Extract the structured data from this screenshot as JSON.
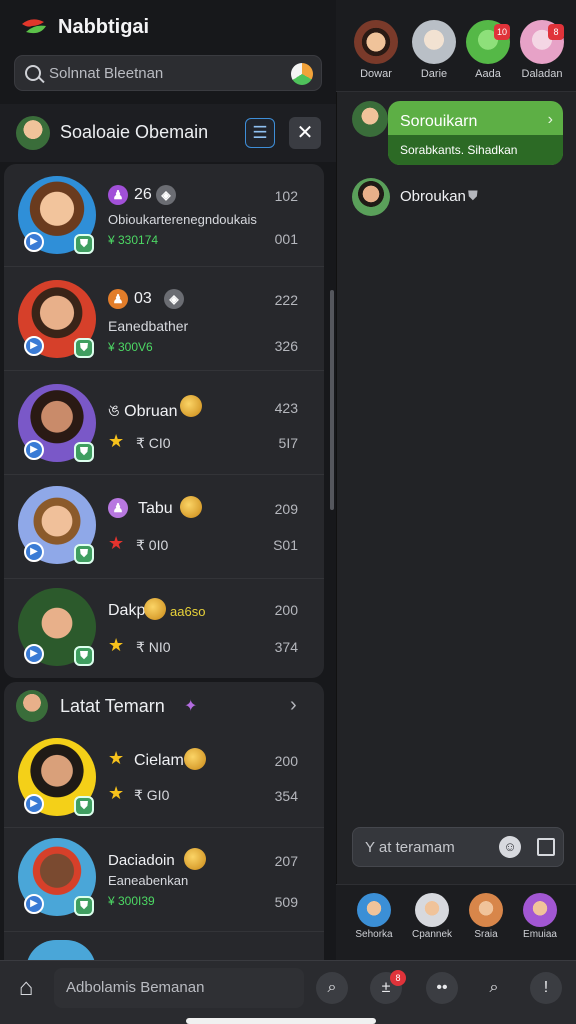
{
  "app": {
    "title": "Nabbtigai"
  },
  "search": {
    "placeholder": "Solnnat Bleetnan"
  },
  "section1": {
    "title": "Soaloaie Obemain"
  },
  "contacts": [
    {
      "badge_num": "26",
      "name": "Obioukarterenegndoukais",
      "sub": "¥ 330174",
      "count_top": "102",
      "count_bottom": "001"
    },
    {
      "badge_num": "03",
      "name": "Eanedbather",
      "sub": "¥ 300V6",
      "count_top": "222",
      "count_bottom": "326"
    },
    {
      "badge_num": "",
      "name": "ঙ Obruan",
      "sub": "₹ CI0",
      "count_top": "423",
      "count_bottom": "5I7"
    },
    {
      "badge_num": "",
      "name": "Tabu",
      "sub": "₹ 0I0",
      "count_top": "209",
      "count_bottom": "S01"
    },
    {
      "badge_num": "",
      "name": "Dakp",
      "name_tag": "aa6so",
      "sub": "₹ NI0",
      "count_top": "200",
      "count_bottom": "374"
    }
  ],
  "section2": {
    "title": "Latat Temarn"
  },
  "latest": [
    {
      "name": "Cielam",
      "sub": "₹ GI0",
      "count_top": "200",
      "count_bottom": "354"
    },
    {
      "name": "Daciadoin",
      "sub_name": "Eaneabenkan",
      "sub": "¥ 300I39",
      "count_top": "207",
      "count_bottom": "509"
    }
  ],
  "top_contacts": [
    {
      "label": "Dowar",
      "color": "#c86d3a"
    },
    {
      "label": "Darie",
      "color": "#b9bfc6"
    },
    {
      "label": "Aada",
      "color": "#55b847",
      "notif": "10"
    },
    {
      "label": "Daladan",
      "color": "#e7a2c7",
      "notif": "8"
    }
  ],
  "chat": {
    "bubble_title": "Sorouikarn",
    "bubble_sub": "Sorabkants. Sihadkan",
    "contact_name": "Obroukan"
  },
  "message_input": {
    "placeholder": "Y at teramam"
  },
  "bottom_contacts": [
    {
      "label": "Sehorka",
      "color": "#3b8fd6"
    },
    {
      "label": "Cpannek",
      "color": "#d7d9de"
    },
    {
      "label": "Sraia",
      "color": "#d8864a"
    },
    {
      "label": "Emuiaa",
      "color": "#a257d3"
    }
  ],
  "bottom_bar": {
    "search_placeholder": "Adbolamis Bemanan",
    "notif": "8"
  }
}
